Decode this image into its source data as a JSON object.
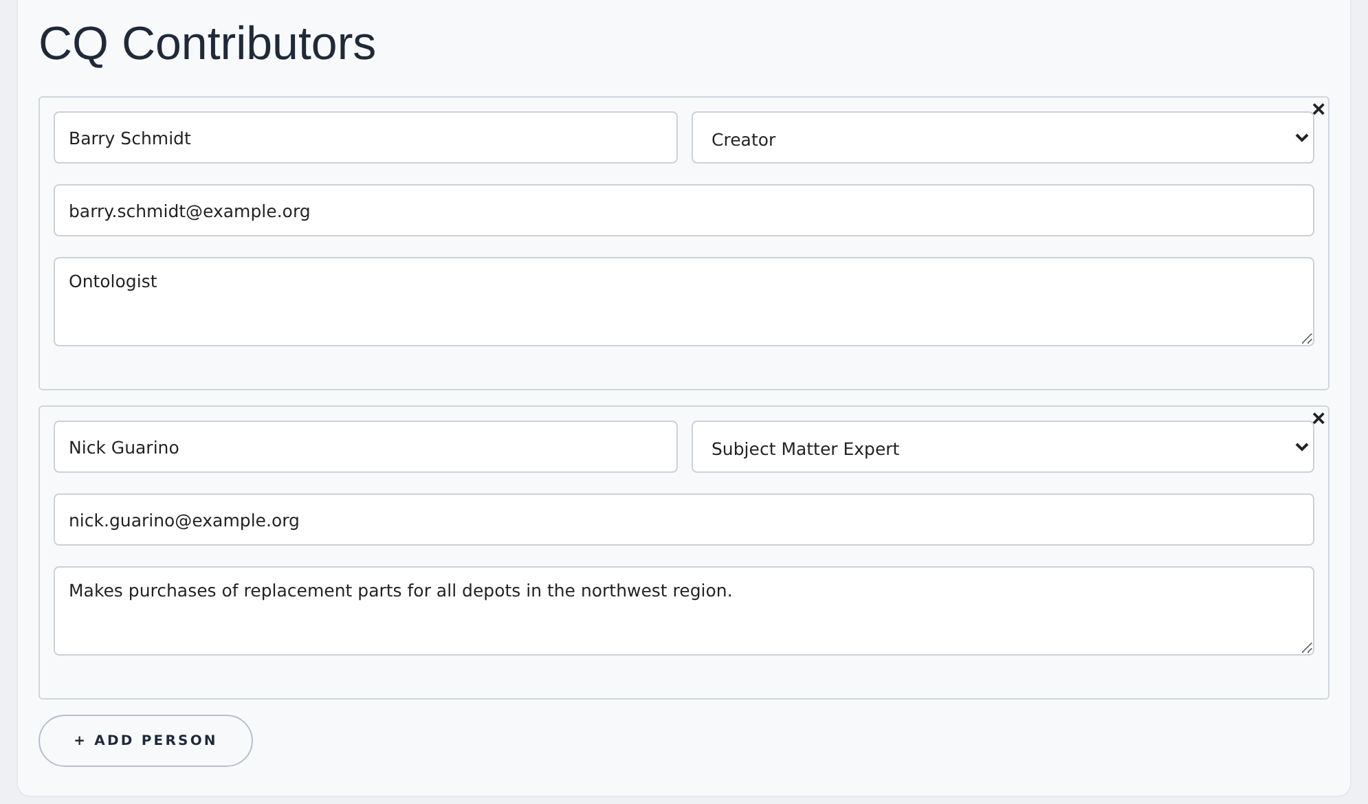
{
  "title": "CQ Contributors",
  "people": [
    {
      "name": "Barry Schmidt",
      "role": "Creator",
      "email": "barry.schmidt@example.org",
      "description": "Ontologist",
      "remove": "×"
    },
    {
      "name": "Nick Guarino",
      "role": "Subject Matter Expert",
      "email": "nick.guarino@example.org",
      "description": "Makes purchases of replacement parts for all depots in the northwest region.",
      "remove": "×"
    }
  ],
  "add_button": "+ ADD PERSON"
}
